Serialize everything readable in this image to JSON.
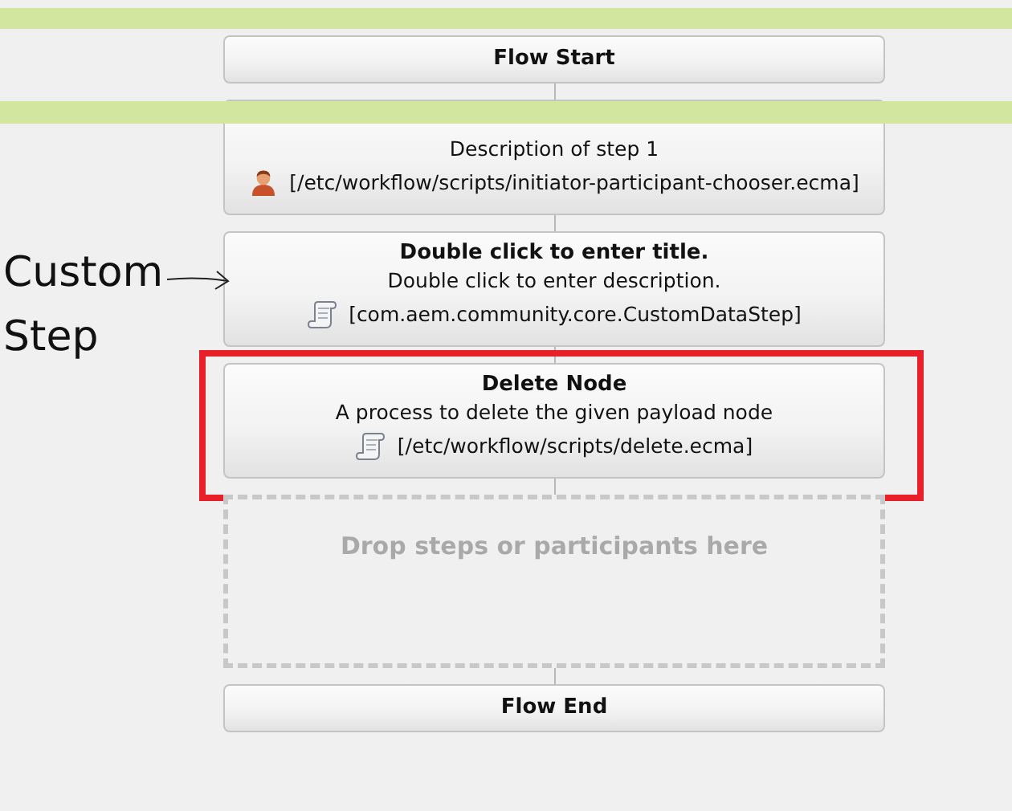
{
  "annotation": {
    "text": "Custom Step"
  },
  "steps": [
    {
      "kind": "terminal",
      "title": "Flow Start",
      "highlighted": false
    },
    {
      "kind": "participant_step",
      "description": "Description of step 1",
      "path": "[/etc/workflow/scripts/initiator-participant-chooser.ecma]",
      "highlighted": false
    },
    {
      "kind": "process_step",
      "title": "Double click to enter title.",
      "description": "Double click to enter description.",
      "path": "[com.aem.community.core.CustomDataStep]",
      "highlighted": false
    },
    {
      "kind": "process_step",
      "title": "Delete Node",
      "description": "A process to delete the given payload node",
      "path": "[/etc/workflow/scripts/delete.ecma]",
      "highlighted": true
    },
    {
      "kind": "drop_zone",
      "text": "Drop steps or participants here",
      "highlighted": false
    },
    {
      "kind": "terminal",
      "title": "Flow End",
      "highlighted": false
    }
  ]
}
